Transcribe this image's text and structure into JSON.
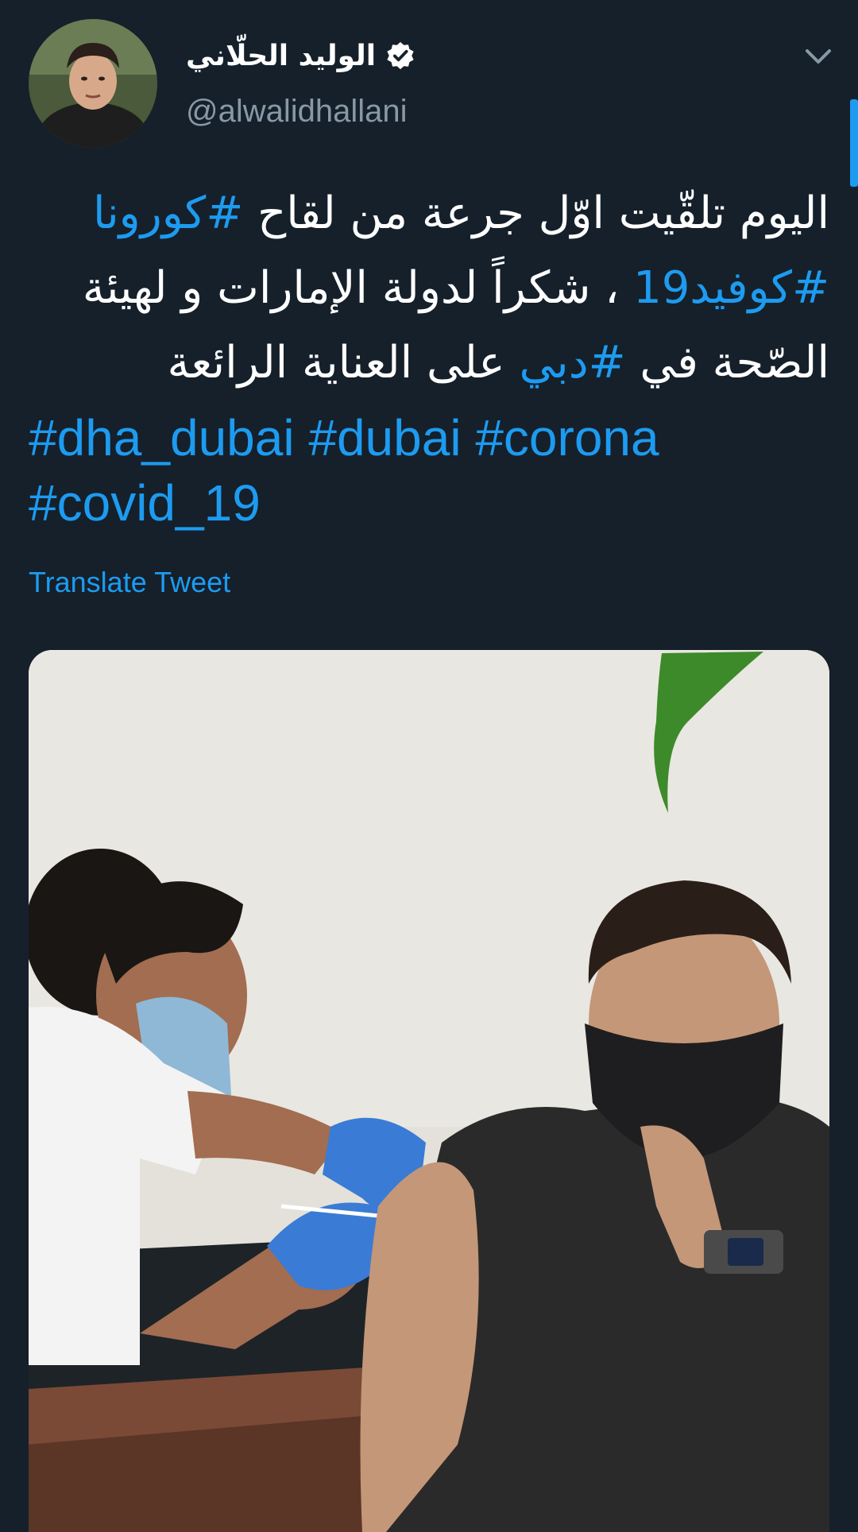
{
  "author": {
    "display_name": "الوليد الحلّاني",
    "handle": "@alwalidhallani",
    "verified": true,
    "avatar_icon": "profile-photo"
  },
  "tweet": {
    "lines_ar": [
      [
        {
          "text": "اليوم تلقّيت اوّل جرعة من لقاح ",
          "tag": false
        },
        {
          "text": "#كورونا",
          "tag": true
        }
      ],
      [
        {
          "text": "#كوفيد19",
          "tag": true
        },
        {
          "text": " ، شكراً لدولة الإمارات و لهيئة",
          "tag": false
        }
      ],
      [
        {
          "text": "الصّحة في ",
          "tag": false
        },
        {
          "text": "#دبي",
          "tag": true
        },
        {
          "text": " على العناية الرائعة",
          "tag": false
        }
      ]
    ],
    "hashtags_en": [
      [
        "#dha_dubai",
        "#dubai",
        "#corona"
      ],
      [
        "#covid_19"
      ]
    ],
    "translate_label": "Translate Tweet"
  },
  "media": {
    "icon": "vaccination-photo"
  },
  "colors": {
    "background": "#15202b",
    "accent": "#1d9bf0",
    "secondary_text": "#8899a6",
    "primary_text": "#ffffff"
  }
}
